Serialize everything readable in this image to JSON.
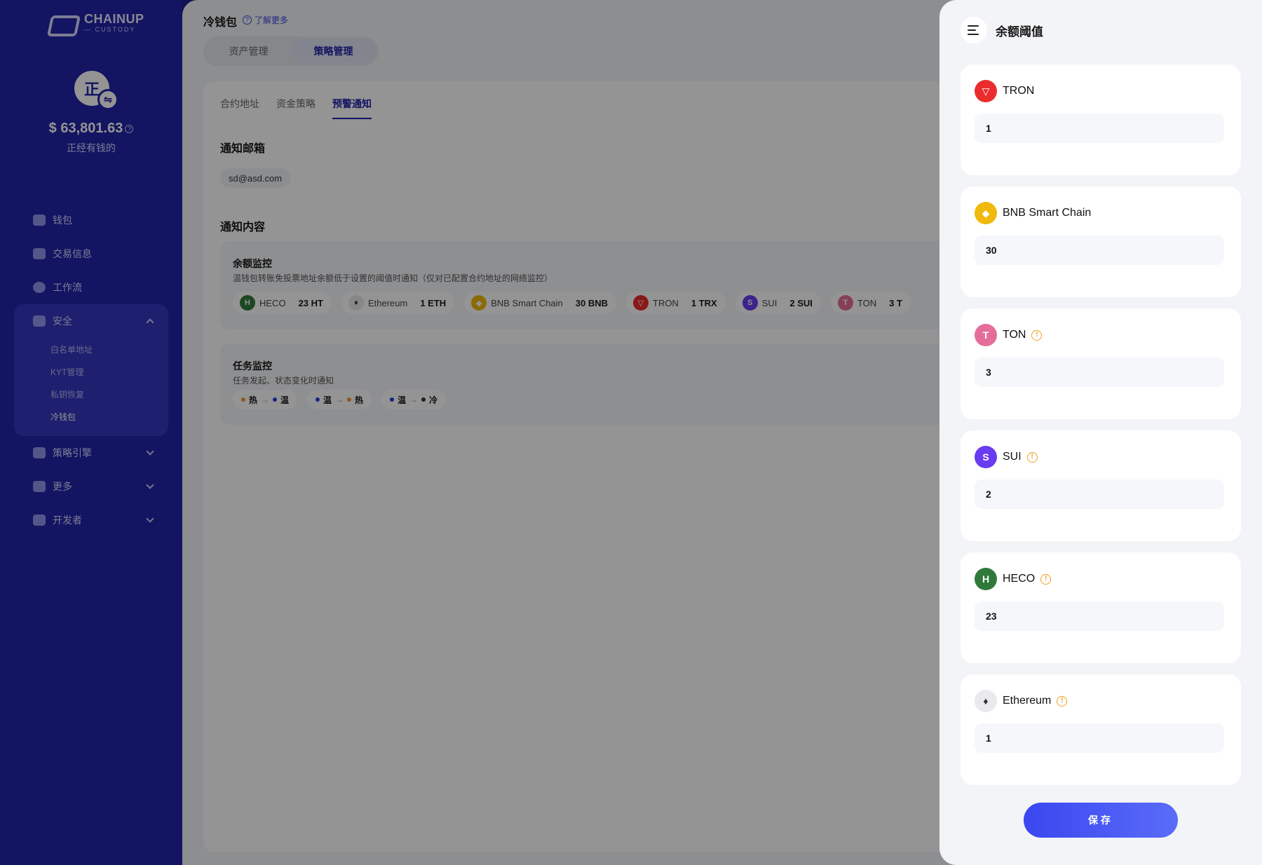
{
  "sidebar": {
    "logo_main": "CHAINUP",
    "logo_sub": "— CUSTODY",
    "avatar_char": "正",
    "avatar_swap": "⇋",
    "balance": "$ 63,801.63",
    "account_name": "正经有钱的",
    "nav": {
      "wallet": "钱包",
      "transactions": "交易信息",
      "workflow": "工作流",
      "security": "安全",
      "security_sub": [
        "白名单地址",
        "KYT管理",
        "私钥恢复",
        "冷钱包"
      ],
      "policy_engine": "策略引擎",
      "more": "更多",
      "developer": "开发者"
    }
  },
  "main": {
    "title": "冷钱包",
    "learn_more": "了解更多",
    "segments": [
      "资产管理",
      "策略管理"
    ],
    "tabs": [
      "合约地址",
      "资金策略",
      "预警通知"
    ],
    "email_section": "通知邮箱",
    "email": "sd@asd.com",
    "content_section": "通知内容",
    "balance_monitor": {
      "title": "余额监控",
      "desc": "温钱包转账免投票地址余额低于设置的阈值时通知（仅对已配置合约地址的网络监控）",
      "chips": [
        {
          "name": "HECO",
          "value": "23 HT",
          "icon": "heco-icon",
          "color": "#2f7a3a",
          "glyph": "H"
        },
        {
          "name": "Ethereum",
          "value": "1 ETH",
          "icon": "ethereum-icon",
          "color": "#e9e9ee",
          "glyph": "♦"
        },
        {
          "name": "BNB Smart Chain",
          "value": "30 BNB",
          "icon": "bnb-icon",
          "color": "#f0b90b",
          "glyph": "◆"
        },
        {
          "name": "TRON",
          "value": "1 TRX",
          "icon": "tron-icon",
          "color": "#eb2c2c",
          "glyph": "▽"
        },
        {
          "name": "SUI",
          "value": "2 SUI",
          "icon": "sui-icon",
          "color": "#6a3cf0",
          "glyph": "S"
        },
        {
          "name": "TON",
          "value": "3 T",
          "icon": "ton-icon",
          "color": "#e56d9a",
          "glyph": "T"
        }
      ]
    },
    "task_monitor": {
      "title": "任务监控",
      "desc": "任务发起、状态变化时通知",
      "flows": [
        {
          "from": "热",
          "to": "温",
          "from_color": "#f09a30",
          "to_color": "#2a3ce0"
        },
        {
          "from": "温",
          "to": "热",
          "from_color": "#2a3ce0",
          "to_color": "#f09a30"
        },
        {
          "from": "温",
          "to": "冷",
          "from_color": "#2a3ce0",
          "to_color": "#333333"
        }
      ],
      "arrow": "→"
    }
  },
  "drawer": {
    "title": "余额阈值",
    "items": [
      {
        "name": "TRON",
        "value": "1",
        "warn": false,
        "icon": "tron-icon",
        "color": "#eb2c2c",
        "glyph": "▽"
      },
      {
        "name": "BNB Smart Chain",
        "value": "30",
        "warn": false,
        "icon": "bnb-icon",
        "color": "#f0b90b",
        "glyph": "◆"
      },
      {
        "name": "TON",
        "value": "3",
        "warn": true,
        "icon": "ton-icon",
        "color": "#e56d9a",
        "glyph": "T"
      },
      {
        "name": "SUI",
        "value": "2",
        "warn": true,
        "icon": "sui-icon",
        "color": "#6a3cf0",
        "glyph": "S"
      },
      {
        "name": "HECO",
        "value": "23",
        "warn": true,
        "icon": "heco-icon",
        "color": "#2f7a3a",
        "glyph": "H"
      },
      {
        "name": "Ethereum",
        "value": "1",
        "warn": true,
        "icon": "ethereum-icon",
        "color": "#e9e9ee",
        "glyph": "♦"
      }
    ],
    "warn_glyph": "!",
    "save_label": "保存"
  },
  "colors": {
    "sidebar": "#2224a9",
    "accent": "#3a47f0",
    "warning": "#f0a020"
  }
}
